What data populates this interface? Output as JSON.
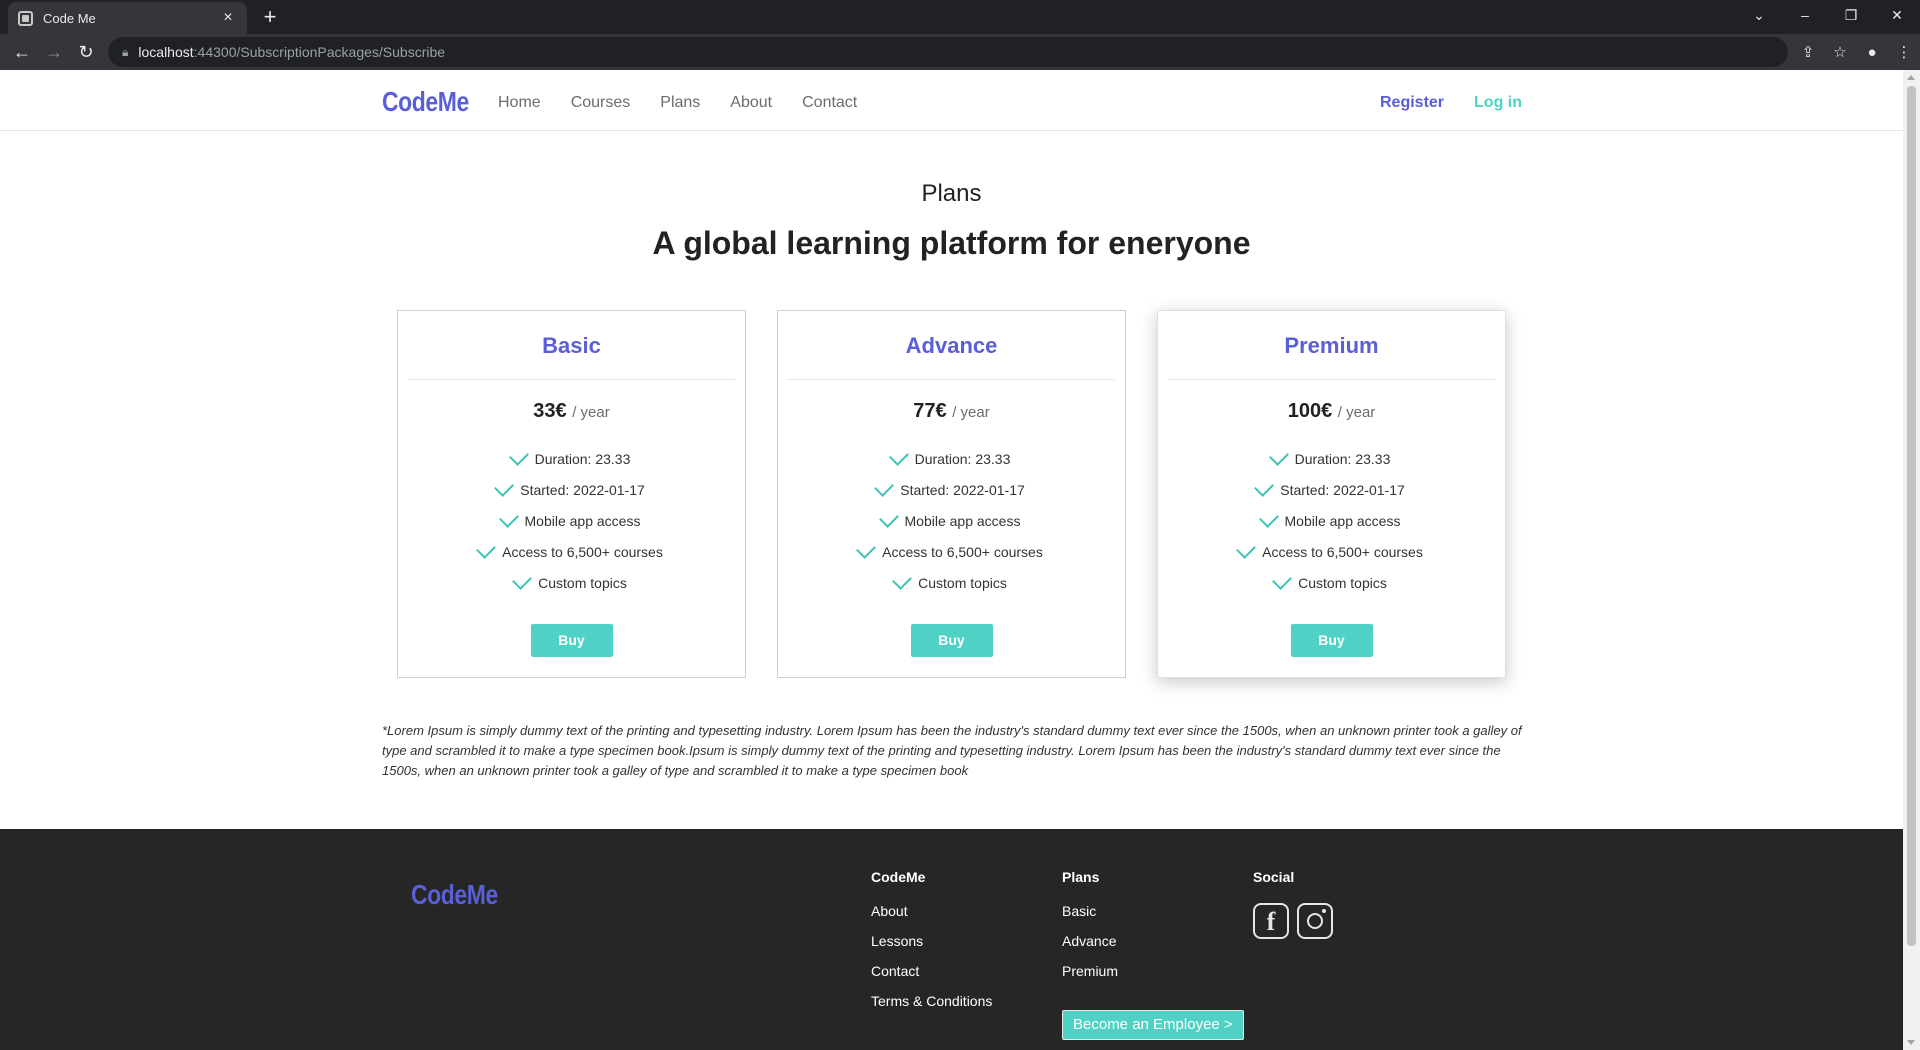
{
  "browser": {
    "tab_title": "Code Me",
    "tab_close": "×",
    "new_tab": "+",
    "url_host": "localhost",
    "url_rest": ":44300/SubscriptionPackages/Subscribe",
    "window_controls": [
      "⌄",
      "–",
      "❐",
      "✕"
    ]
  },
  "header": {
    "brand": "CodeMe",
    "nav": [
      "Home",
      "Courses",
      "Plans",
      "About",
      "Contact"
    ],
    "register": "Register",
    "login": "Log in"
  },
  "hero": {
    "subtitle": "Plans",
    "title": "A global learning platform for eneryone"
  },
  "plans": [
    {
      "name": "Basic",
      "price": "33€",
      "period": "/ year",
      "features": [
        "Duration: 23.33",
        "Started: 2022-01-17",
        "Mobile app access",
        "Access to 6,500+ courses",
        "Custom topics"
      ],
      "button": "Buy"
    },
    {
      "name": "Advance",
      "price": "77€",
      "period": "/ year",
      "features": [
        "Duration: 23.33",
        "Started: 2022-01-17",
        "Mobile app access",
        "Access to 6,500+ courses",
        "Custom topics"
      ],
      "button": "Buy"
    },
    {
      "name": "Premium",
      "price": "100€",
      "period": "/ year",
      "features": [
        "Duration: 23.33",
        "Started: 2022-01-17",
        "Mobile app access",
        "Access to 6,500+ courses",
        "Custom topics"
      ],
      "button": "Buy"
    }
  ],
  "disclaimer": "*Lorem Ipsum is simply dummy text of the printing and typesetting industry. Lorem Ipsum has been the industry's standard dummy text ever since the 1500s, when an unknown printer took a galley of type and scrambled it to make a type specimen book.Ipsum is simply dummy text of the printing and typesetting industry. Lorem Ipsum has been the industry's standard dummy text ever since the 1500s, when an unknown printer took a galley of type and scrambled it to make a type specimen book",
  "footer": {
    "brand": "CodeMe",
    "col1": {
      "title": "CodeMe",
      "links": [
        "About",
        "Lessons",
        "Contact",
        "Terms & Conditions"
      ]
    },
    "col2": {
      "title": "Plans",
      "links": [
        "Basic",
        "Advance",
        "Premium"
      ]
    },
    "col3": {
      "title": "Social",
      "icons": [
        "facebook-icon",
        "instagram-icon"
      ]
    },
    "employee_button": "Become an Employee >"
  },
  "colors": {
    "brand": "#5a5fd8",
    "accent": "#4fd1c5",
    "footer_bg": "#262626"
  }
}
